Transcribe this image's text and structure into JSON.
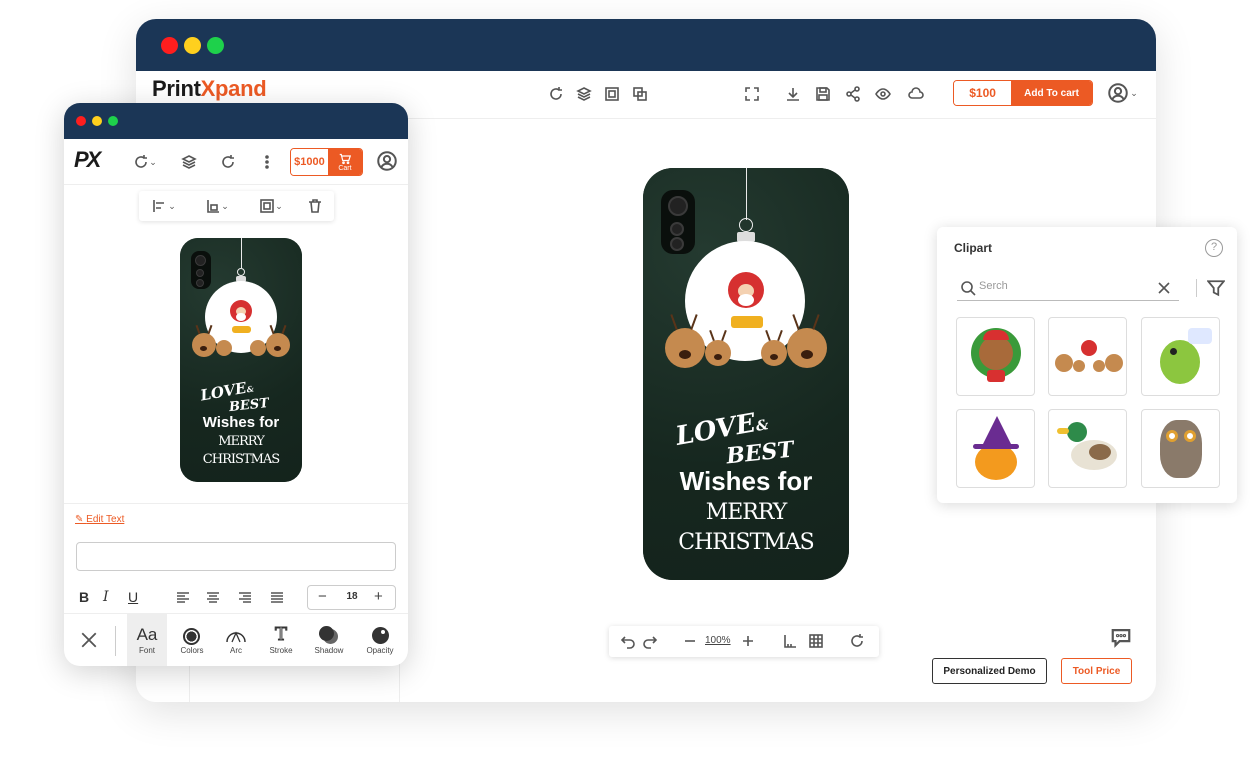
{
  "colors": {
    "navy": "#1b3656",
    "accent": "#ec5a24",
    "case": "#17271f"
  },
  "desktop": {
    "logo": {
      "part1": "Print",
      "part2": "Xpand"
    },
    "toolbar_icons": [
      "rotate-icon",
      "layers-icon",
      "crop-icon",
      "duplicate-icon",
      "fullscreen-icon",
      "download-icon",
      "save-icon",
      "share-icon",
      "preview-icon",
      "cloud-icon"
    ],
    "price": "$100",
    "add_to_cart": "Add To cart",
    "zoom": "100%",
    "personalized_demo": "Personalized Demo",
    "tool_price": "Tool Price"
  },
  "design_text": {
    "line1": "LOVE",
    "line1b": "&",
    "line2": "BEST",
    "line3": "Wishes for",
    "line4": "MERRY",
    "line5": "CHRISTMAS"
  },
  "clipart": {
    "title": "Clipart",
    "search_placeholder": "Serch",
    "items": [
      "teddy-bear",
      "reindeer-sleigh",
      "green-dinosaur",
      "pumpkin-witch",
      "duck",
      "owl"
    ]
  },
  "mobile": {
    "logo": "PX",
    "price": "$1000",
    "cart": "Cart",
    "edit_text": "Edit Text",
    "font_size": "18",
    "tools": [
      {
        "label": "Font",
        "icon": "font-icon"
      },
      {
        "label": "Colors",
        "icon": "colors-icon"
      },
      {
        "label": "Arc",
        "icon": "arc-icon"
      },
      {
        "label": "Stroke",
        "icon": "stroke-icon"
      },
      {
        "label": "Shadow",
        "icon": "shadow-icon"
      },
      {
        "label": "Opacity",
        "icon": "opacity-icon"
      }
    ],
    "font_glyph": "Aa",
    "stroke_glyph": "T"
  }
}
